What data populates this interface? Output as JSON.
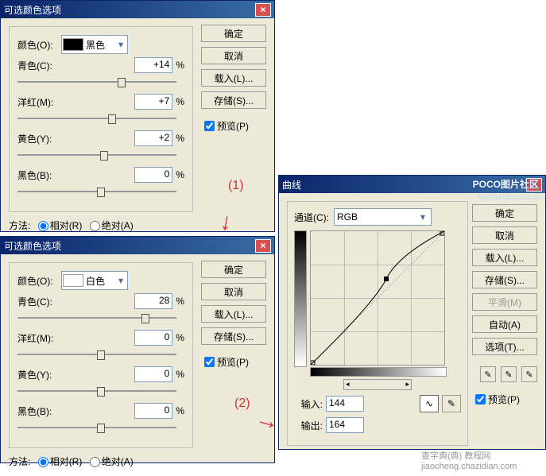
{
  "sc1": {
    "title": "可选颜色选项",
    "close": "×",
    "colorLabel": "颜色(O):",
    "colorName": "黑色",
    "colorSwatch": "#000000",
    "sliders": [
      {
        "label": "青色(C):",
        "value": "+14",
        "thumb": 63
      },
      {
        "label": "洋红(M):",
        "value": "+7",
        "thumb": 57
      },
      {
        "label": "黄色(Y):",
        "value": "+2",
        "thumb": 52
      },
      {
        "label": "黑色(B):",
        "value": "0",
        "thumb": 50
      }
    ],
    "buttons": {
      "ok": "确定",
      "cancel": "取消",
      "load": "载入(L)...",
      "save": "存储(S)..."
    },
    "preview": "预览(P)",
    "methodLabel": "方法:",
    "rel": "相对(R)",
    "abs": "绝对(A)"
  },
  "sc2": {
    "title": "可选颜色选项",
    "close": "×",
    "colorLabel": "颜色(O):",
    "colorName": "白色",
    "colorSwatch": "#ffffff",
    "sliders": [
      {
        "label": "青色(C):",
        "value": "28",
        "thumb": 78
      },
      {
        "label": "洋红(M):",
        "value": "0",
        "thumb": 50
      },
      {
        "label": "黄色(Y):",
        "value": "0",
        "thumb": 50
      },
      {
        "label": "黑色(B):",
        "value": "0",
        "thumb": 50
      }
    ],
    "buttons": {
      "ok": "确定",
      "cancel": "取消",
      "load": "载入(L)...",
      "save": "存储(S)..."
    },
    "preview": "预览(P)",
    "methodLabel": "方法:",
    "rel": "相对(R)",
    "abs": "绝对(A)"
  },
  "curves": {
    "title": "曲线",
    "close": "×",
    "channelLabel": "通道(C):",
    "channel": "RGB",
    "inLabel": "输入:",
    "inVal": "144",
    "outLabel": "输出:",
    "outVal": "164",
    "buttons": {
      "ok": "确定",
      "cancel": "取消",
      "load": "载入(L)...",
      "save": "存储(S)...",
      "smooth": "平滑(M)",
      "auto": "自动(A)",
      "options": "选项(T)..."
    },
    "preview": "预览(P)",
    "watermark": "POCO图片社区",
    "watermark2": "http://photo.poco.cn"
  },
  "annot": {
    "one": "(1)",
    "two": "(2)"
  },
  "footer": "查字典(典) 教程网 jiaocheng.chazidian.com",
  "chart_data": {
    "type": "line",
    "title": "Curves",
    "xlabel": "Input",
    "ylabel": "Output",
    "xlim": [
      0,
      255
    ],
    "ylim": [
      0,
      255
    ],
    "series": [
      {
        "name": "RGB",
        "values": [
          [
            0,
            0
          ],
          [
            144,
            164
          ],
          [
            255,
            255
          ]
        ]
      }
    ]
  }
}
